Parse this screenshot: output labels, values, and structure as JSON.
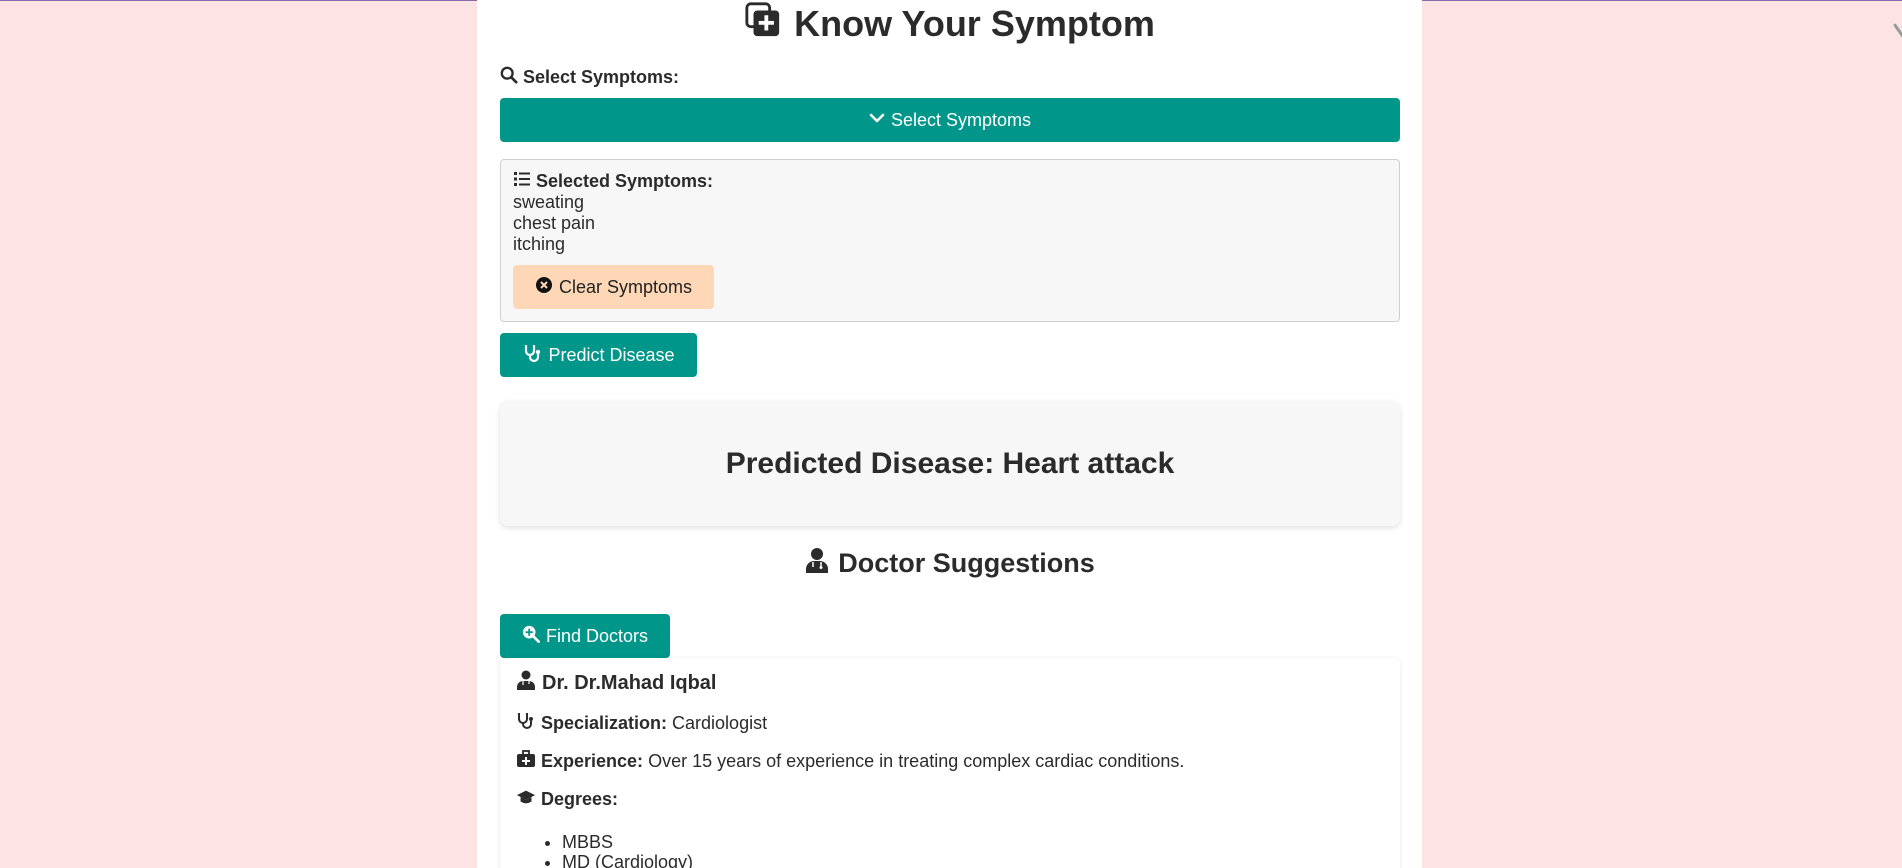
{
  "app": {
    "title": "Know Your Symptom"
  },
  "selector": {
    "label": "Select Symptoms:",
    "button_label": "Select Symptoms"
  },
  "selected": {
    "heading": "Selected Symptoms:",
    "items": [
      "sweating",
      "chest pain",
      "itching"
    ],
    "clear_label": "Clear Symptoms"
  },
  "predict": {
    "button_label": "Predict Disease"
  },
  "result": {
    "text": "Predicted Disease: Heart attack"
  },
  "doctors": {
    "section_title": "Doctor Suggestions",
    "find_label": "Find Doctors",
    "card": {
      "name": "Dr. Dr.Mahad Iqbal",
      "specialization_label": "Specialization:",
      "specialization": "Cardiologist",
      "experience_label": "Experience:",
      "experience": "Over 15 years of experience in treating complex cardiac conditions.",
      "degrees_label": "Degrees:",
      "degrees": [
        "MBBS",
        "MD (Cardiology)"
      ]
    }
  },
  "colors": {
    "page_bg": "#fde4e4",
    "accent": "#00968a",
    "clear_button": "#fed8b6"
  }
}
